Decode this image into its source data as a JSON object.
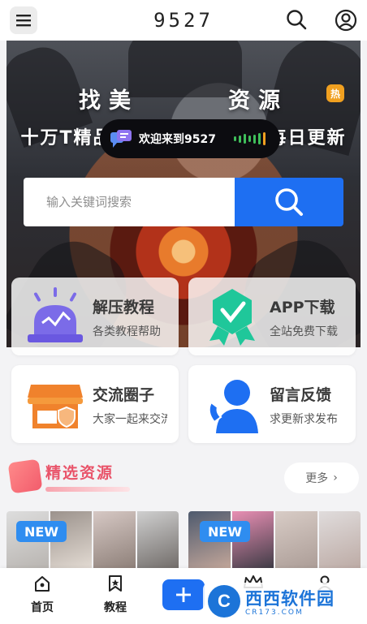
{
  "header": {
    "title": "9527",
    "menu_icon": "hamburger-menu-icon",
    "search_icon": "search-icon",
    "profile_icon": "user-icon"
  },
  "hero": {
    "title_left": "找美",
    "title_right": "资源",
    "hot_badge": "热",
    "subtitle": "十万T精品资源，全部免费，每日更新",
    "welcome_text": "欢迎来到9527",
    "search_placeholder": "输入关键词搜索"
  },
  "cards": [
    {
      "title": "解压教程",
      "desc": "各类教程帮助",
      "icon": "alarm-light-icon",
      "accent": "#7b6be8"
    },
    {
      "title": "APP下载",
      "desc": "全站免费下载",
      "icon": "badge-check-icon",
      "accent": "#1fc79a"
    },
    {
      "title": "交流圈子",
      "desc": "大家一起来交流",
      "icon": "store-icon",
      "accent": "#f0822c"
    },
    {
      "title": "留言反馈",
      "desc": "求更新求发布",
      "icon": "customer-service-icon",
      "accent": "#1e6ff2"
    }
  ],
  "section": {
    "title": "精选资源",
    "more": "更多"
  },
  "thumbnails": {
    "badge_left": "NEW",
    "badge_right": "NEW"
  },
  "nav": [
    {
      "label": "首页",
      "icon": "home-icon"
    },
    {
      "label": "教程",
      "icon": "bookmark-icon"
    },
    {
      "label": "",
      "icon": "plus-icon"
    },
    {
      "label": "",
      "icon": "crown-icon"
    },
    {
      "label": "",
      "icon": "user-icon"
    }
  ],
  "watermark": {
    "logo": "C",
    "text": "西西软件园",
    "sub": "CR173.COM"
  },
  "colors": {
    "primary": "#1e6ff2",
    "accent_pink": "#e9546a"
  }
}
